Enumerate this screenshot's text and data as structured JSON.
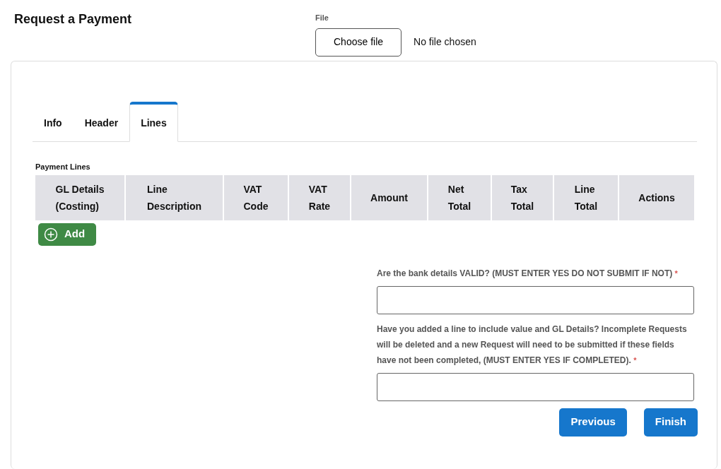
{
  "page_title": "Request a Payment",
  "file": {
    "label": "File",
    "button": "Choose file",
    "status": "No file chosen"
  },
  "tabs": [
    {
      "label": "Info",
      "selected": false
    },
    {
      "label": "Header",
      "selected": false
    },
    {
      "label": "Lines",
      "selected": true
    }
  ],
  "table": {
    "caption": "Payment Lines",
    "columns": [
      [
        "GL Details",
        "(Costing)"
      ],
      [
        "Line",
        "Description"
      ],
      [
        "VAT",
        "Code"
      ],
      [
        "VAT",
        "Rate"
      ],
      [
        "Amount"
      ],
      [
        "Net",
        "Total"
      ],
      [
        "Tax",
        "Total"
      ],
      [
        "Line",
        "Total"
      ],
      [
        "Actions"
      ]
    ]
  },
  "add_button": "Add",
  "questions": [
    {
      "label": "Are the bank details VALID? (MUST ENTER YES DO NOT SUBMIT IF NOT)",
      "required_mark": "*"
    },
    {
      "label": "Have you added a line to include value and GL Details? Incomplete Requests will be deleted and a new Request will need to be submitted if these fields have not been completed, (MUST ENTER YES IF COMPLETED).",
      "required_mark": "*"
    }
  ],
  "buttons": [
    "Previous",
    "Finish"
  ]
}
